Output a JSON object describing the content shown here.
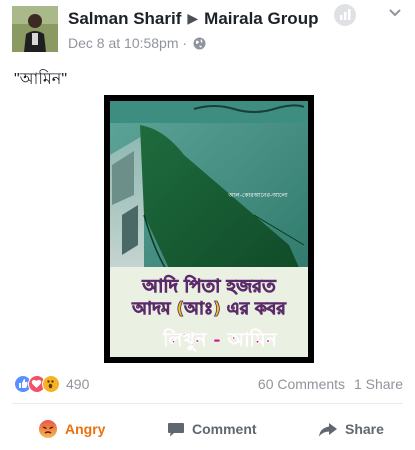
{
  "post": {
    "author": "Salman Sharif",
    "group": "Mairala Group",
    "date": "Dec 8 at 10:58pm",
    "separator": "·",
    "text": "\"আমিন\""
  },
  "image": {
    "watermark": "আল-কোরআনের-আলো",
    "caption_line1": "আদি পিতা হজরত",
    "caption_line2": "আদম (আঃ) এর কবর",
    "caption_line3": "লিখুন - আমিন"
  },
  "stats": {
    "reaction_count": "490",
    "comments": "60 Comments",
    "shares": "1 Share"
  },
  "actions": {
    "react_label": "Angry",
    "comment_label": "Comment",
    "share_label": "Share"
  },
  "colors": {
    "angry": "#e9710f",
    "like": "#5890ff",
    "love": "#f25268",
    "wow": "#f7b125"
  }
}
